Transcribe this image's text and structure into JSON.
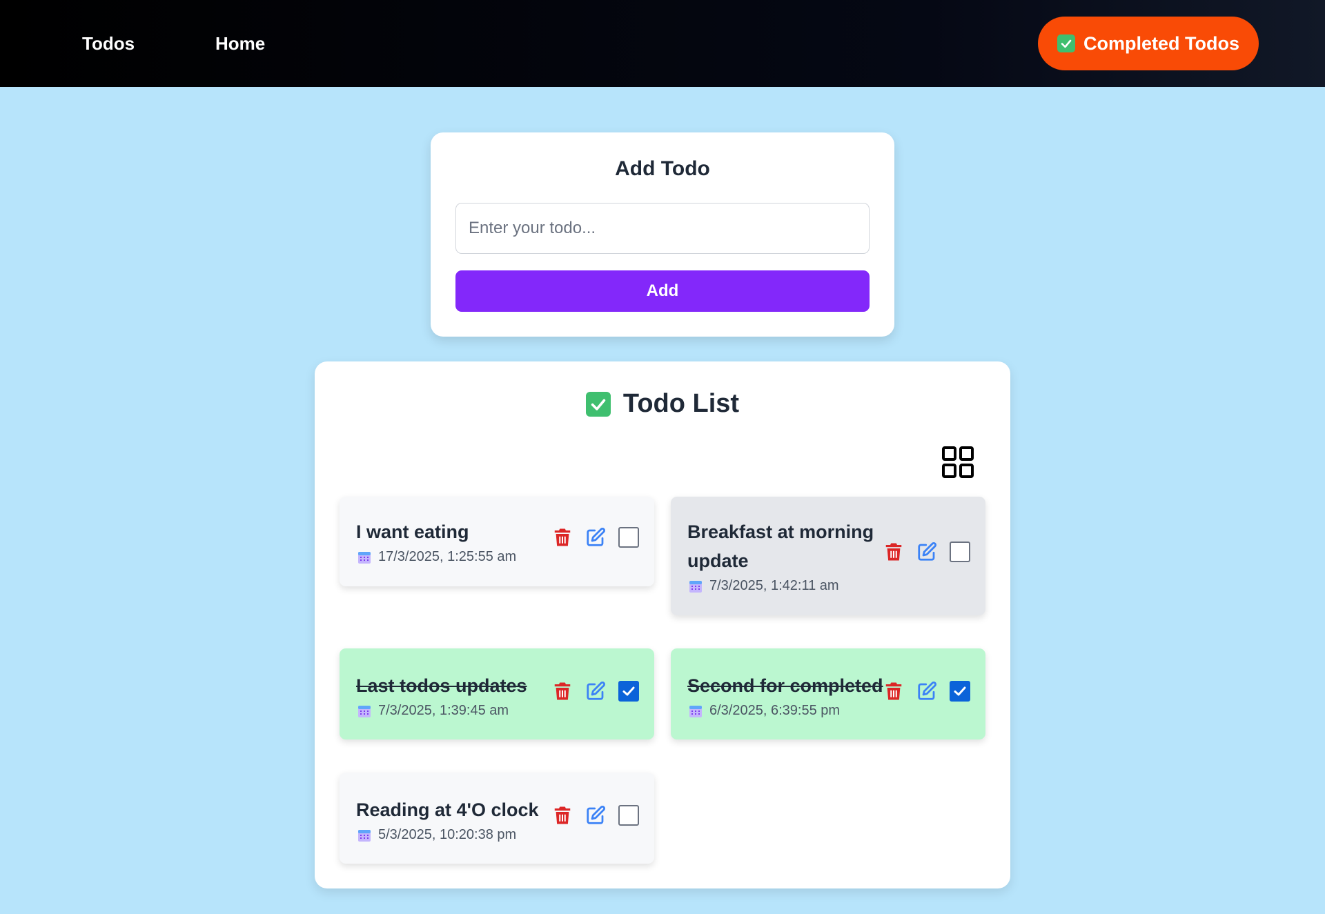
{
  "nav": {
    "todos_label": "Todos",
    "home_label": "Home",
    "completed_label": "Completed Todos"
  },
  "add_card": {
    "title": "Add Todo",
    "input_placeholder": "Enter your todo...",
    "input_value": "",
    "add_label": "Add"
  },
  "list": {
    "title": "Todo List",
    "items": [
      {
        "text": "I want eating",
        "date": "17/3/2025, 1:25:55 am",
        "completed": false
      },
      {
        "text": "Breakfast at morning update",
        "date": "7/3/2025, 1:42:11 am",
        "completed": false
      },
      {
        "text": "Last todos updates",
        "date": "7/3/2025, 1:39:45 am",
        "completed": true
      },
      {
        "text": "Second for completed",
        "date": "6/3/2025, 6:39:55 pm",
        "completed": true
      },
      {
        "text": "Reading at 4'O clock",
        "date": "5/3/2025, 10:20:38 pm",
        "completed": false
      }
    ]
  },
  "colors": {
    "background": "#b7e4fb",
    "accent_orange": "#f94b06",
    "accent_purple": "#8328fa",
    "completed_bg": "#bbf7d0",
    "delete_red": "#dc2626",
    "edit_blue": "#3b82f6",
    "checkbox_blue": "#0b63d9"
  },
  "icons": {
    "grid": "grid-view-icon",
    "delete": "trash-icon",
    "edit": "edit-icon",
    "calendar": "calendar-icon",
    "check": "check-emoji-icon"
  }
}
